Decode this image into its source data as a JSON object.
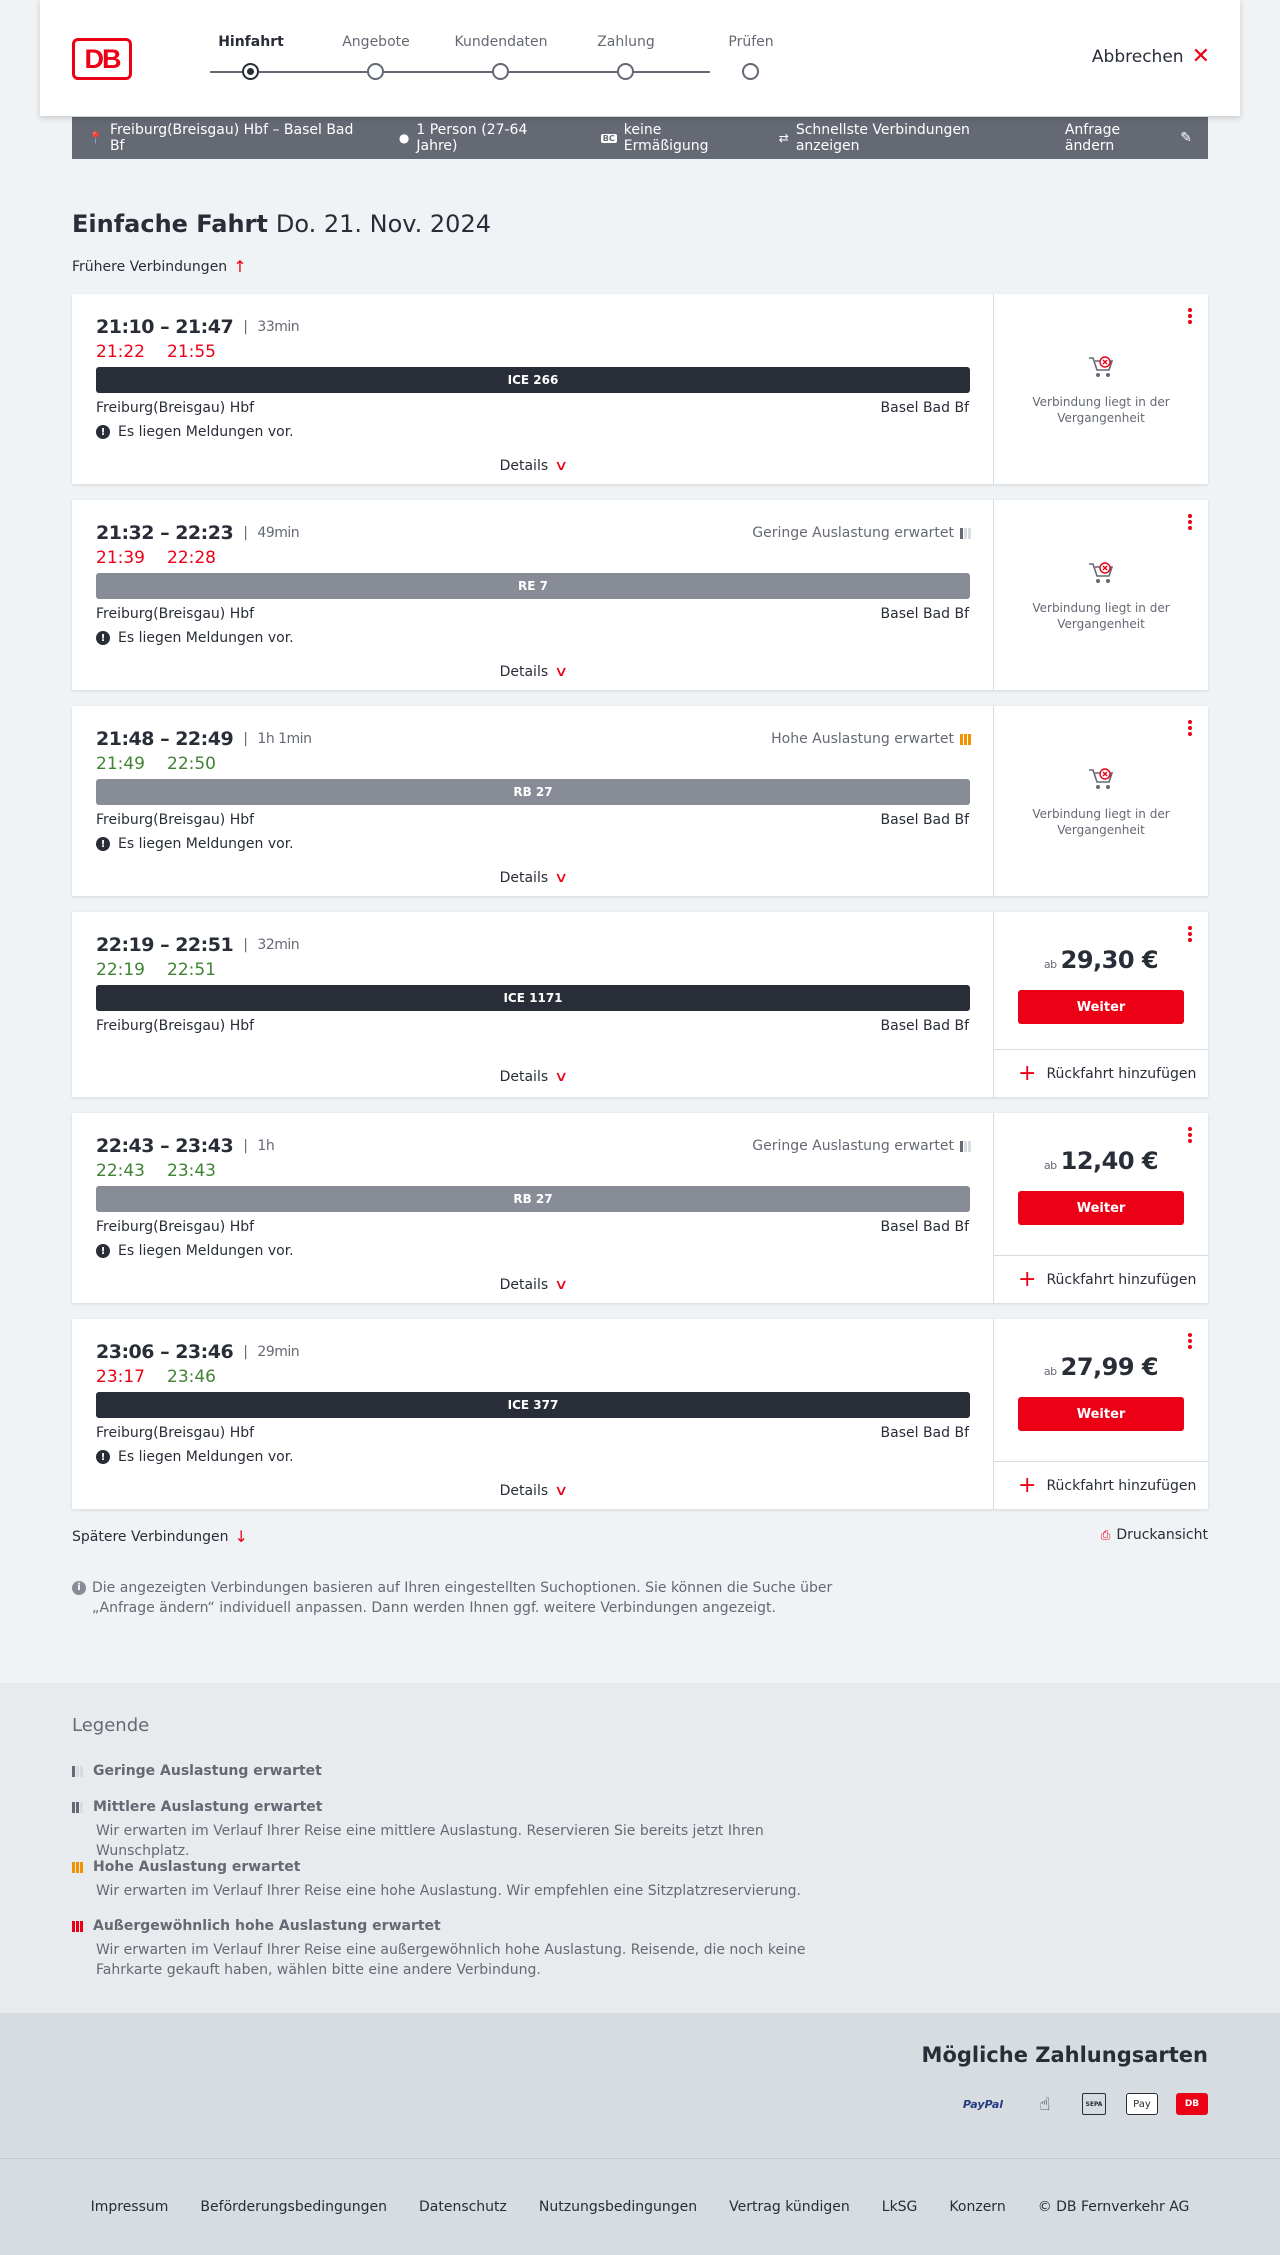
{
  "header": {
    "logo": "DB",
    "steps": [
      "Hinfahrt",
      "Angebote",
      "Kundendaten",
      "Zahlung",
      "Prüfen"
    ],
    "cancel": "Abbrechen"
  },
  "query": {
    "route": "Freiburg(Breisgau) Hbf – Basel Bad Bf",
    "persons": "1 Person (27-64 Jahre)",
    "discount": "keine Ermäßigung",
    "fastest": "Schnellste Verbindungen anzeigen",
    "change": "Anfrage ändern",
    "discount_badge": "BC"
  },
  "title": {
    "label": "Einfache Fahrt",
    "date": "Do. 21. Nov. 2024"
  },
  "earlier": "Frühere Verbindungen",
  "later": "Spätere Verbindungen",
  "print": "Druckansicht",
  "details_label": "Details",
  "messages_label": "Es liegen Meldungen vor.",
  "past_label": "Verbindung liegt in der Vergangenheit",
  "price_prefix": "ab",
  "button_label": "Weiter",
  "return_label": "Rückfahrt hinzufügen",
  "connections": [
    {
      "times": "21:10 – 21:47",
      "duration": "33min",
      "rt_dep": "21:22",
      "rt_arr": "21:55",
      "dep_color": "red",
      "arr_color": "red",
      "occupancy": "",
      "train": "ICE 266",
      "from": "Freiburg(Breisgau) Hbf",
      "to": "Basel Bad Bf",
      "messages": true,
      "past": true,
      "price": ""
    },
    {
      "times": "21:32 – 22:23",
      "duration": "49min",
      "rt_dep": "21:39",
      "rt_arr": "22:28",
      "dep_color": "red",
      "arr_color": "red",
      "occupancy": "Geringe Auslastung erwartet",
      "occupancy_level": "low",
      "train": "RE 7",
      "from": "Freiburg(Breisgau) Hbf",
      "to": "Basel Bad Bf",
      "messages": true,
      "past": true,
      "price": ""
    },
    {
      "times": "21:48 – 22:49",
      "duration": "1h 1min",
      "rt_dep": "21:49",
      "rt_arr": "22:50",
      "dep_color": "green",
      "arr_color": "green",
      "occupancy": "Hohe Auslastung erwartet",
      "occupancy_level": "high",
      "train": "RB 27",
      "from": "Freiburg(Breisgau) Hbf",
      "to": "Basel Bad Bf",
      "messages": true,
      "past": true,
      "price": ""
    },
    {
      "times": "22:19 – 22:51",
      "duration": "32min",
      "rt_dep": "22:19",
      "rt_arr": "22:51",
      "dep_color": "green",
      "arr_color": "green",
      "occupancy": "",
      "train": "ICE 1171",
      "from": "Freiburg(Breisgau) Hbf",
      "to": "Basel Bad Bf",
      "messages": false,
      "past": false,
      "price": "29,30 €"
    },
    {
      "times": "22:43 – 23:43",
      "duration": "1h",
      "rt_dep": "22:43",
      "rt_arr": "23:43",
      "dep_color": "green",
      "arr_color": "green",
      "occupancy": "Geringe Auslastung erwartet",
      "occupancy_level": "low",
      "train": "RB 27",
      "from": "Freiburg(Breisgau) Hbf",
      "to": "Basel Bad Bf",
      "messages": true,
      "past": false,
      "price": "12,40 €"
    },
    {
      "times": "23:06 – 23:46",
      "duration": "29min",
      "rt_dep": "23:17",
      "rt_arr": "23:46",
      "dep_color": "red",
      "arr_color": "green",
      "occupancy": "",
      "train": "ICE 377",
      "from": "Freiburg(Breisgau) Hbf",
      "to": "Basel Bad Bf",
      "messages": true,
      "past": false,
      "price": "27,99 €"
    }
  ],
  "info": "Die angezeigten Verbindungen basieren auf Ihren eingestellten Suchoptionen. Sie können die Suche über „Anfrage ändern“ individuell anpassen. Dann werden Ihnen ggf. weitere Verbindungen angezeigt.",
  "legend": {
    "title": "Legende",
    "items": [
      {
        "title": "Geringe Auslastung erwartet",
        "desc": ""
      },
      {
        "title": "Mittlere Auslastung erwartet",
        "desc": "Wir erwarten im Verlauf Ihrer Reise eine mittlere Auslastung. Reservieren Sie bereits jetzt Ihren Wunschplatz."
      },
      {
        "title": "Hohe Auslastung erwartet",
        "desc": "Wir erwarten im Verlauf Ihrer Reise eine hohe Auslastung. Wir empfehlen eine Sitzplatzreservierung."
      },
      {
        "title": "Außergewöhnlich hohe Auslastung erwartet",
        "desc": "Wir erwarten im Verlauf Ihrer Reise eine außergewöhnlich hohe Auslastung. Reisende, die noch keine Fahrkarte gekauft haben, wählen bitte eine andere Verbindung."
      }
    ]
  },
  "payment": {
    "title": "Mögliche Zahlungsarten",
    "methods": [
      "PayPal",
      "credit-card",
      "SEPA",
      "Pay",
      "DB"
    ]
  },
  "footer": [
    "Impressum",
    "Beförderungsbedingungen",
    "Datenschutz",
    "Nutzungsbedingungen",
    "Vertrag kündigen",
    "LkSG",
    "Konzern",
    "© DB Fernverkehr AG"
  ]
}
